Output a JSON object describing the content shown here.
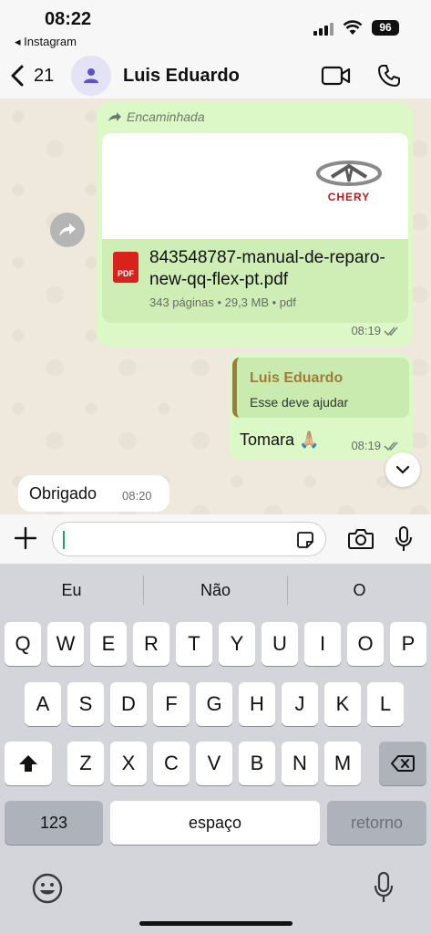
{
  "status": {
    "time": "08:22",
    "back_app": "◂ Instagram",
    "battery": "96"
  },
  "header": {
    "back_count": "21",
    "contact_name": "Luis Eduardo"
  },
  "messages": {
    "forwarded_label": "Encaminhada",
    "document": {
      "brand": "CHERY",
      "file_name": "843548787-manual-de-reparo-new-qq-flex-pt.pdf",
      "meta": "343 páginas • 29,3 MB • pdf",
      "icon_label": "PDF",
      "time": "08:19"
    },
    "reply": {
      "quoted_name": "Luis Eduardo",
      "quoted_text": "Esse deve ajudar",
      "text": "Tomara 🙏🏼",
      "time": "08:19"
    },
    "incoming": {
      "text": "Obrigado",
      "time": "08:20"
    }
  },
  "input": {
    "value": ""
  },
  "keyboard": {
    "suggestions": [
      "Eu",
      "Não",
      "O"
    ],
    "row1": [
      "Q",
      "W",
      "E",
      "R",
      "T",
      "Y",
      "U",
      "I",
      "O",
      "P"
    ],
    "row2": [
      "A",
      "S",
      "D",
      "F",
      "G",
      "H",
      "J",
      "K",
      "L"
    ],
    "row3": [
      "Z",
      "X",
      "C",
      "V",
      "B",
      "N",
      "M"
    ],
    "numbers_label": "123",
    "space_label": "espaço",
    "return_label": "retorno"
  },
  "colors": {
    "outgoing_bubble": "#dcf8c6",
    "quote_accent": "#a07d36",
    "pdf_red": "#d9221c",
    "caret": "#1fa855"
  }
}
